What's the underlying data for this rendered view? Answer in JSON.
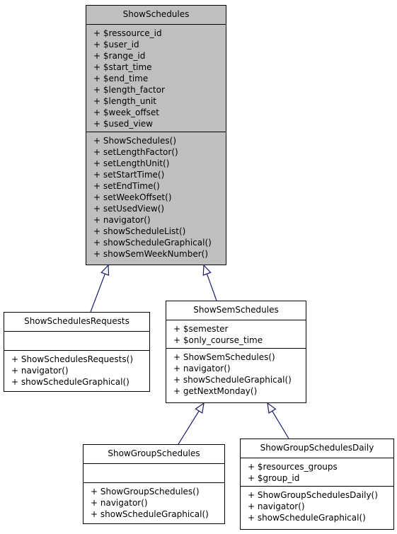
{
  "diagram": {
    "edge_color": "#191970",
    "base_fill": "#bfbfbf",
    "classes": {
      "show_schedules": {
        "name": "ShowSchedules",
        "attributes": [
          "+ $ressource_id",
          "+ $user_id",
          "+ $range_id",
          "+ $start_time",
          "+ $end_time",
          "+ $length_factor",
          "+ $length_unit",
          "+ $week_offset",
          "+ $used_view"
        ],
        "methods": [
          "+ ShowSchedules()",
          "+ setLengthFactor()",
          "+ setLengthUnit()",
          "+ setStartTime()",
          "+ setEndTime()",
          "+ setWeekOffset()",
          "+ setUsedView()",
          "+ navigator()",
          "+ showScheduleList()",
          "+ showScheduleGraphical()",
          "+ showSemWeekNumber()"
        ]
      },
      "show_schedules_requests": {
        "name": "ShowSchedulesRequests",
        "attributes": [],
        "methods": [
          "+ ShowSchedulesRequests()",
          "+ navigator()",
          "+ showScheduleGraphical()"
        ]
      },
      "show_sem_schedules": {
        "name": "ShowSemSchedules",
        "attributes": [
          "+ $semester",
          "+ $only_course_time"
        ],
        "methods": [
          "+ ShowSemSchedules()",
          "+ navigator()",
          "+ showScheduleGraphical()",
          "+ getNextMonday()"
        ]
      },
      "show_group_schedules": {
        "name": "ShowGroupSchedules",
        "attributes": [],
        "methods": [
          "+ ShowGroupSchedules()",
          "+ navigator()",
          "+ showScheduleGraphical()"
        ]
      },
      "show_group_schedules_daily": {
        "name": "ShowGroupSchedulesDaily",
        "attributes": [
          "+ $resources_groups",
          "+ $group_id"
        ],
        "methods": [
          "+ ShowGroupSchedulesDaily()",
          "+ navigator()",
          "+ showScheduleGraphical()"
        ]
      }
    },
    "inheritance": [
      {
        "child": "ShowSchedulesRequests",
        "parent": "ShowSchedules"
      },
      {
        "child": "ShowSemSchedules",
        "parent": "ShowSchedules"
      },
      {
        "child": "ShowGroupSchedules",
        "parent": "ShowSemSchedules"
      },
      {
        "child": "ShowGroupSchedulesDaily",
        "parent": "ShowSemSchedules"
      }
    ]
  }
}
